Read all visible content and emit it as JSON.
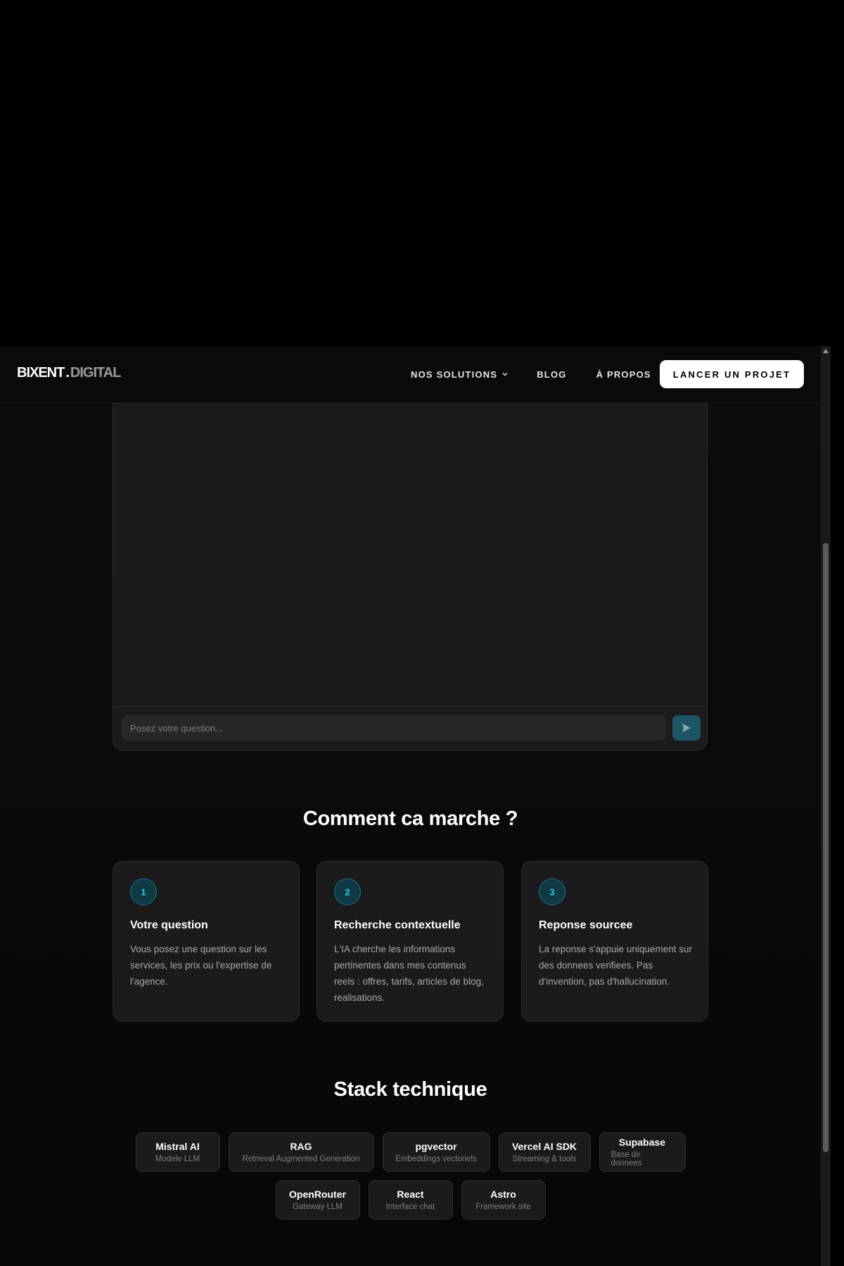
{
  "header": {
    "logo_main": "BIXENT",
    "logo_dot": ".",
    "logo_sub": "DIGITAL",
    "nav": {
      "solutions": "NOS SOLUTIONS",
      "blog": "BLOG",
      "about": "À PROPOS"
    },
    "cta": "LANCER UN PROJET"
  },
  "chat": {
    "input_placeholder": "Posez votre question...",
    "send_icon": "send-icon"
  },
  "how": {
    "title": "Comment ca marche ?",
    "steps": [
      {
        "number": "1",
        "title": "Votre question",
        "text": "Vous posez une question sur les services, les prix ou l'expertise de l'agence."
      },
      {
        "number": "2",
        "title": "Recherche contextuelle",
        "text": "L'IA cherche les informations pertinentes dans mes contenus reels : offres, tarifs, articles de blog, realisations."
      },
      {
        "number": "3",
        "title": "Reponse sourcee",
        "text": "La reponse s'appuie uniquement sur des donnees verifiees. Pas d'invention, pas d'hallucination."
      }
    ]
  },
  "stack": {
    "title": "Stack technique",
    "items": [
      {
        "name": "Mistral AI",
        "desc": "Modele LLM"
      },
      {
        "name": "RAG",
        "desc": "Retrieval Augmented Generation"
      },
      {
        "name": "pgvector",
        "desc": "Embeddings vectoriels"
      },
      {
        "name": "Vercel AI SDK",
        "desc": "Streaming & tools"
      },
      {
        "name": "Supabase",
        "desc": "Base de donnees"
      },
      {
        "name": "OpenRouter",
        "desc": "Gateway LLM"
      },
      {
        "name": "React",
        "desc": "Interface chat"
      },
      {
        "name": "Astro",
        "desc": "Framework site"
      }
    ]
  },
  "colors": {
    "accent": "#2ec8e6",
    "send_button": "#1d5566",
    "card_bg": "#1b1b1d"
  }
}
